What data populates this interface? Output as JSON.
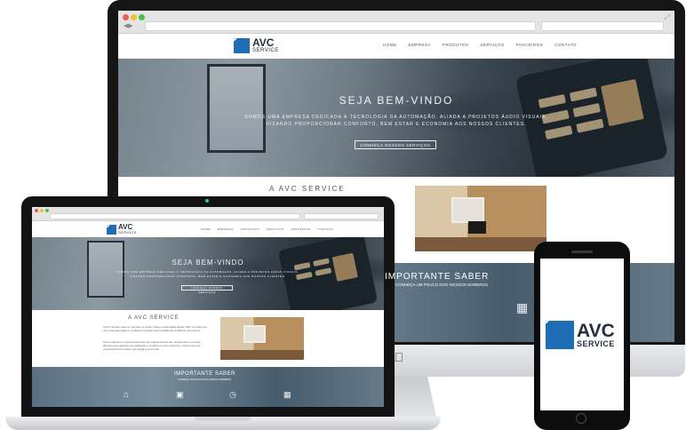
{
  "site": {
    "logo": {
      "name": "AVC",
      "sub": "SERVICE"
    },
    "nav": [
      "HOME",
      "EMPRESA",
      "PRODUTOS",
      "SERVIÇOS",
      "PARCEIROS",
      "CONTATO"
    ],
    "hero": {
      "title": "SEJA BEM-VINDO",
      "line1": "Somos uma empresa dedicada à tecnologia da automação, aliada a projetos áudio visuais,",
      "line2": "visando proporcionar conforto, bem estar e economia aos nossos clientes.",
      "button": "Conheça nossos serviços"
    },
    "about": {
      "title": "A AVC SERVICE",
      "p1": "A AVC Service atua no mercado de Áudio Vídeo e Automação desde 1997. É referência nas mais avançadas e modernas soluções para residências do Brasil e do exterior.",
      "p2": "Nosso objetivo é o desenvolvimento de projetos funcionais, oferecendo um serviço diferente que garanta sua satisfação e conforto em seu ambiente, visando sempre proporcionar bem estar, tecnologia e economia."
    },
    "important": {
      "title": "IMPORTANTE SABER",
      "sub": "CONHEÇA UM POUCO DOS NOSSOS NÚMEROS",
      "desktop_title": "IMPORTANTE SABER",
      "desktop_sub": "CONHEÇA UM POUCO DOS NOSSOS NÚMEROS"
    }
  },
  "phone": {
    "logo": {
      "name": "AVC",
      "sub": "SERVICE"
    }
  },
  "colors": {
    "brand": "#1f6db5",
    "dark": "#243041"
  }
}
